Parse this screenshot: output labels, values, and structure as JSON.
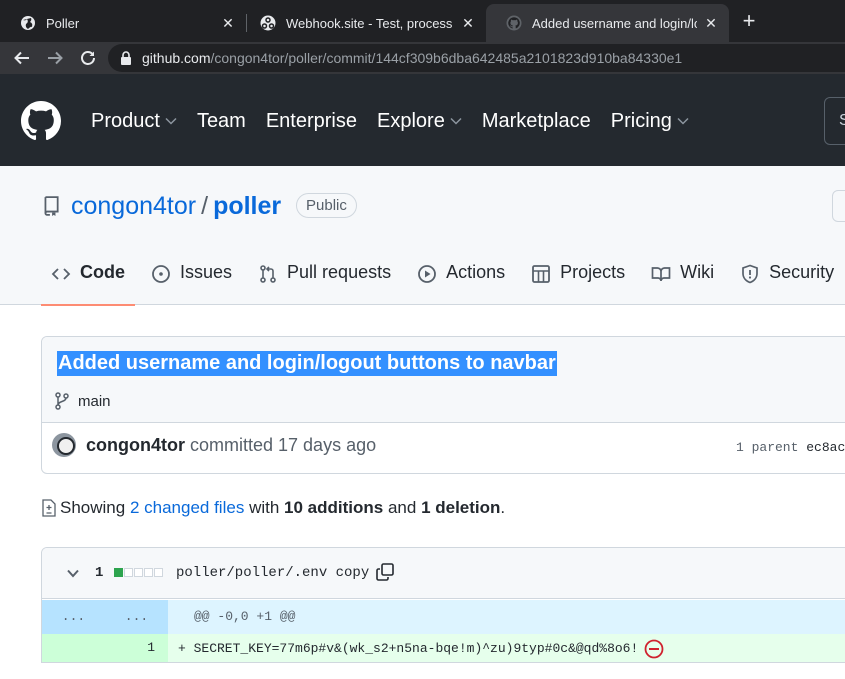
{
  "browser": {
    "tabs": [
      {
        "title": "Poller",
        "icon": "globe-icon",
        "active": false
      },
      {
        "title": "Webhook.site - Test, process and",
        "icon": "webhook-icon",
        "active": false
      },
      {
        "title": "Added username and login/logou",
        "icon": "github-icon",
        "active": true
      }
    ],
    "new_tab": "+",
    "close_glyph": "✕",
    "url_host": "github.com",
    "url_path": "/congon4tor/poller/commit/144cf309b6dba642485a2101823d910ba84330e1"
  },
  "header": {
    "nav": [
      {
        "label": "Product",
        "dropdown": true
      },
      {
        "label": "Team",
        "dropdown": false
      },
      {
        "label": "Enterprise",
        "dropdown": false
      },
      {
        "label": "Explore",
        "dropdown": true
      },
      {
        "label": "Marketplace",
        "dropdown": false
      },
      {
        "label": "Pricing",
        "dropdown": true
      }
    ],
    "search_stub": "S"
  },
  "repo": {
    "owner": "congon4tor",
    "separator": "/",
    "name": "poller",
    "visibility": "Public",
    "tabs": [
      {
        "label": "Code",
        "icon": "code-icon",
        "selected": true
      },
      {
        "label": "Issues",
        "icon": "issues-icon",
        "selected": false
      },
      {
        "label": "Pull requests",
        "icon": "pull-request-icon",
        "selected": false
      },
      {
        "label": "Actions",
        "icon": "actions-icon",
        "selected": false
      },
      {
        "label": "Projects",
        "icon": "projects-icon",
        "selected": false
      },
      {
        "label": "Wiki",
        "icon": "wiki-icon",
        "selected": false
      },
      {
        "label": "Security",
        "icon": "security-icon",
        "selected": false
      }
    ]
  },
  "commit": {
    "title": "Added username and login/logout buttons to navbar",
    "branch": "main",
    "author": "congon4tor",
    "action": "committed 17 days ago",
    "parent_label": "1 parent",
    "parent_sha": "ec8ac"
  },
  "summary": {
    "prefix": "Showing",
    "changed_files": "2 changed files",
    "with": "with",
    "additions": "10 additions",
    "and": "and",
    "deletions": "1 deletion",
    "end": "."
  },
  "file": {
    "change_count": "1",
    "diffstat": [
      "add",
      "neutral",
      "neutral",
      "neutral",
      "neutral"
    ],
    "path": "poller/poller/.env copy",
    "hunk_left": "...",
    "hunk_right": "...",
    "hunk_header": "@@ -0,0 +1 @@",
    "line_number": "1",
    "added_line": "+ SECRET_KEY=77m6p#v&(wk_s2+n5na-bqe!m)^zu)9typ#0c&@qd%8o6!"
  },
  "colors": {
    "header_bg": "#24292f",
    "link": "#0969da",
    "selection": "#3390ff",
    "tab_underline": "#fd8c73",
    "addition_bg": "#e6ffec",
    "hunk_bg": "#ddf4ff",
    "error_red": "#cf222e"
  }
}
